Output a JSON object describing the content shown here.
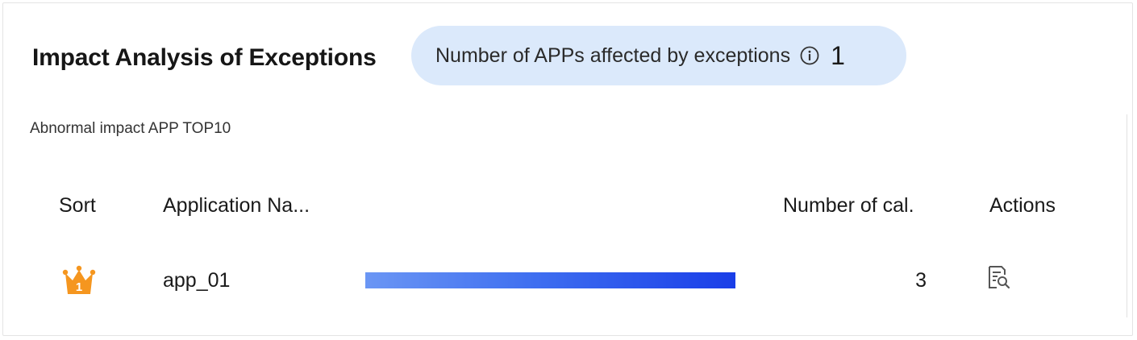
{
  "header": {
    "title": "Impact Analysis of Exceptions",
    "stat_label": "Number of APPs affected by exceptions",
    "stat_value": "1",
    "stat_info_icon": "info-circle-icon",
    "stat_bg_color": "#dbe9fb"
  },
  "section": {
    "title": "Abnormal impact APP TOP10"
  },
  "table": {
    "columns": [
      "Sort",
      "Application Na...",
      "Number of cal.",
      "Actions"
    ],
    "rows": [
      {
        "rank": "1",
        "rank_icon": "crown-icon",
        "app_name": "app_01",
        "bar_fraction": 1.0,
        "count": "3",
        "action_icon": "document-search-icon"
      }
    ]
  },
  "colors": {
    "rank_crown": "#f5961f",
    "bar_start": "#6b96f4",
    "bar_end": "#1a3ee8"
  }
}
